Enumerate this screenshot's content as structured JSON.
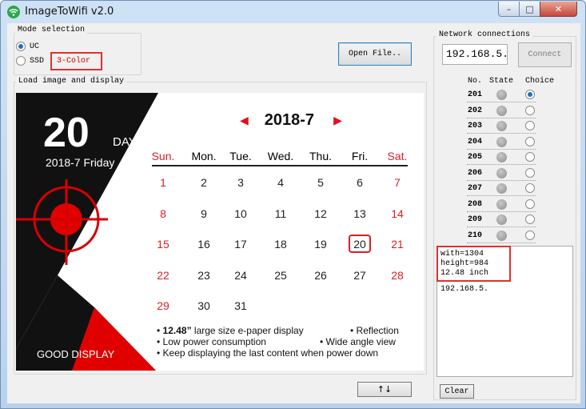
{
  "window": {
    "title": "ImageToWifi v2.0",
    "controls": {
      "minimize": "–",
      "maximize": "□",
      "close": "✕"
    }
  },
  "mode_selection": {
    "legend": "Mode selection",
    "options": [
      {
        "label": "UC",
        "checked": true
      },
      {
        "label": "SSD",
        "checked": false
      }
    ],
    "color_mode": "3-Color"
  },
  "open_file_label": "Open File..",
  "load_image": {
    "legend": "Load image and display",
    "epaper": {
      "day_number": "20",
      "day_label": "DAY",
      "date_line": "2018-7 Friday",
      "brand": "GOOD DISPLAY",
      "month_title": "2018-7",
      "prev_arrow": "◀",
      "next_arrow": "▶",
      "weekdays": [
        "Sun.",
        "Mon.",
        "Tue.",
        "Wed.",
        "Thu.",
        "Fri.",
        "Sat."
      ],
      "weeks": [
        [
          "1",
          "2",
          "3",
          "4",
          "5",
          "6",
          "7"
        ],
        [
          "8",
          "9",
          "10",
          "11",
          "12",
          "13",
          "14"
        ],
        [
          "15",
          "16",
          "17",
          "18",
          "19",
          "20",
          "21"
        ],
        [
          "22",
          "23",
          "24",
          "25",
          "26",
          "27",
          "28"
        ],
        [
          "29",
          "30",
          "31",
          "",
          "",
          "",
          ""
        ]
      ],
      "highlighted_day": "20",
      "features": [
        {
          "bullet": "•",
          "bold": "12.48”",
          "text": " large size e-paper display"
        },
        {
          "bullet": "•",
          "bold": "",
          "text": " Reflection"
        },
        {
          "bullet": "•",
          "bold": "",
          "text": " Low power consumption"
        },
        {
          "bullet": "•",
          "bold": "",
          "text": " Wide angle view"
        },
        {
          "bullet": "•",
          "bold": "",
          "text": " Keep displaying the last content when power down"
        }
      ],
      "colors": {
        "accent": "#d81f26",
        "dark": "#111111"
      }
    },
    "swap_label": "↑↓"
  },
  "network": {
    "legend": "Network connections",
    "ip_value": "192.168.5.",
    "connect_label": "Connect",
    "headers": {
      "no": "No.",
      "state": "State",
      "choice": "Choice"
    },
    "devices": [
      {
        "no": "201",
        "selected": true
      },
      {
        "no": "202",
        "selected": false
      },
      {
        "no": "203",
        "selected": false
      },
      {
        "no": "204",
        "selected": false
      },
      {
        "no": "205",
        "selected": false
      },
      {
        "no": "206",
        "selected": false
      },
      {
        "no": "207",
        "selected": false
      },
      {
        "no": "208",
        "selected": false
      },
      {
        "no": "209",
        "selected": false
      },
      {
        "no": "210",
        "selected": false
      }
    ],
    "log": [
      "with=1304",
      "height=984",
      "12.48 inch",
      "192.168.5."
    ],
    "clear_label": "Clear"
  }
}
